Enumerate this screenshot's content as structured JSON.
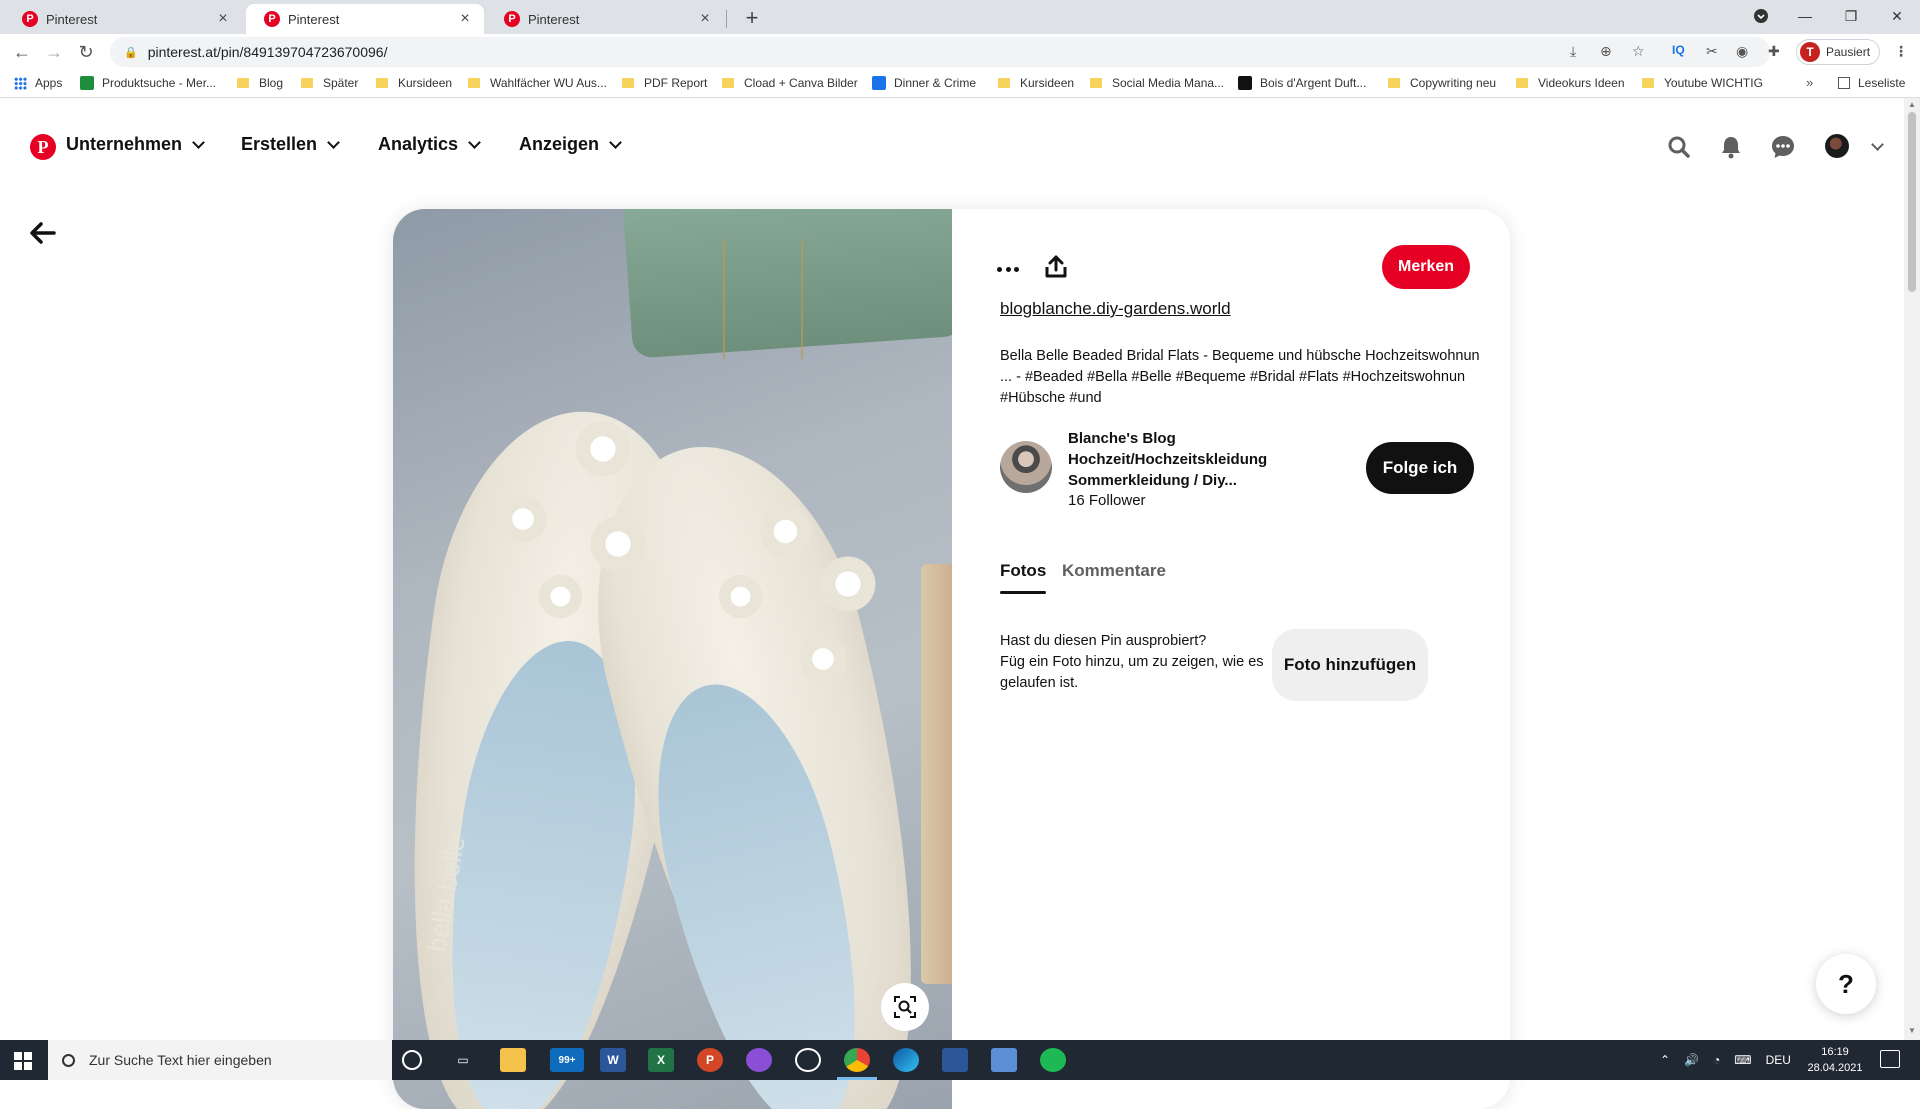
{
  "browser": {
    "tabs": [
      {
        "title": "Pinterest",
        "active": false
      },
      {
        "title": "Pinterest",
        "active": true
      },
      {
        "title": "Pinterest",
        "active": false
      }
    ],
    "url": "pinterest.at/pin/849139704723670096/",
    "profile_label": "Pausiert",
    "profile_initial": "T",
    "bookmarks": [
      {
        "label": "Apps",
        "type": "apps"
      },
      {
        "label": "Produktsuche - Mer...",
        "type": "site",
        "color": "#1e8e3e"
      },
      {
        "label": "Blog",
        "type": "folder"
      },
      {
        "label": "Später",
        "type": "folder"
      },
      {
        "label": "Kursideen",
        "type": "folder"
      },
      {
        "label": "Wahlfächer WU Aus...",
        "type": "folder"
      },
      {
        "label": "PDF Report",
        "type": "folder"
      },
      {
        "label": "Cload + Canva Bilder",
        "type": "folder"
      },
      {
        "label": "Dinner & Crime",
        "type": "site",
        "color": "#1a73e8"
      },
      {
        "label": "Kursideen",
        "type": "folder"
      },
      {
        "label": "Social Media Mana...",
        "type": "folder"
      },
      {
        "label": "Bois d'Argent Duft...",
        "type": "site",
        "color": "#111111"
      },
      {
        "label": "Copywriting neu",
        "type": "folder"
      },
      {
        "label": "Videokurs Ideen",
        "type": "folder"
      },
      {
        "label": "Youtube WICHTIG",
        "type": "folder"
      }
    ],
    "more_bookmarks": "»",
    "reading_list": "Leseliste"
  },
  "header": {
    "logo": "P",
    "menus": [
      "Unternehmen",
      "Erstellen",
      "Analytics",
      "Anzeigen"
    ],
    "icons": [
      "search-icon",
      "bell-icon",
      "chat-icon",
      "profile-avatar",
      "account-chevron"
    ]
  },
  "pin": {
    "save_label": "Merken",
    "source": "blogblanche.diy-gardens.world",
    "description": "Bella Belle Beaded Bridal Flats - Bequeme und hübsche Hochzeitswohnun ... - #Beaded #Bella #Belle #Bequeme #Bridal #Flats #Hochzeitswohnun #Hübsche #und",
    "creator": {
      "name": "Blanche's Blog Hochzeit/Hochzeitskleidung Sommerkleidung / Diy...",
      "followers": "16 Follower",
      "follow_label": "Folge ich"
    },
    "tabs": [
      "Fotos",
      "Kommentare"
    ],
    "tried_line1": "Hast du diesen Pin ausprobiert?",
    "tried_line2": "Füg ein Foto hinzu, um zu zeigen, wie es gelaufen ist.",
    "add_photo_label": "Foto hinzufügen",
    "image_brand": "bella belle"
  },
  "help_label": "?",
  "taskbar": {
    "search_placeholder": "Zur Suche Text hier eingeben",
    "mail_badge": "99+",
    "language": "DEU",
    "time": "16:19",
    "date": "28.04.2021"
  },
  "colors": {
    "pinterest_red": "#e60023",
    "follow_black": "#111111",
    "taskbar": "#1f2833"
  }
}
